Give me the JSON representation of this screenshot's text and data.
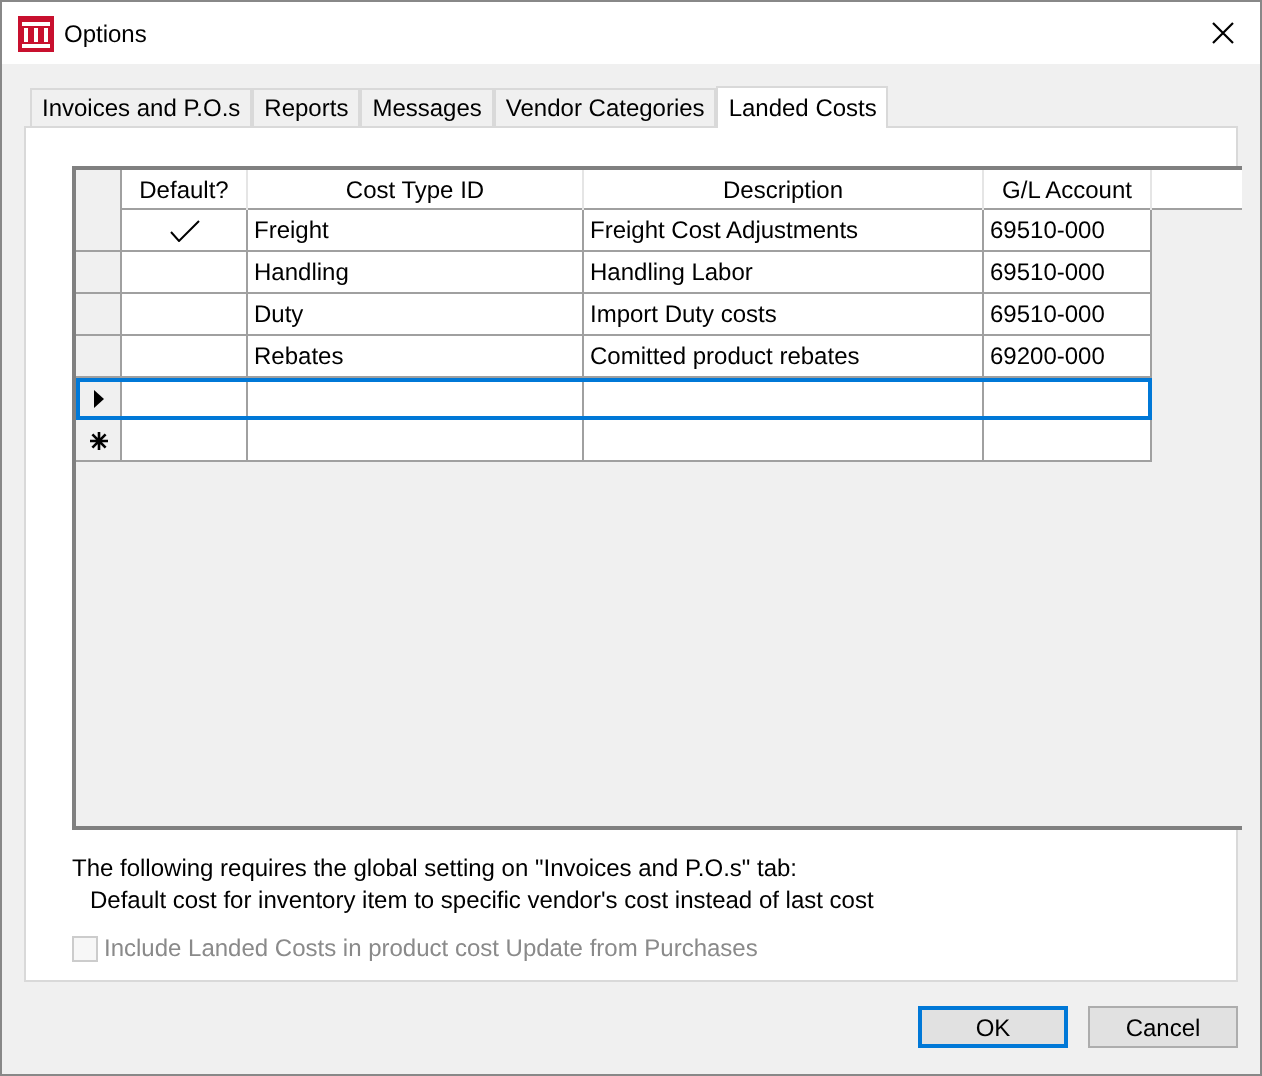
{
  "window": {
    "title": "Options"
  },
  "tabs": [
    {
      "label": "Invoices and P.O.s",
      "selected": false
    },
    {
      "label": "Reports",
      "selected": false
    },
    {
      "label": "Messages",
      "selected": false
    },
    {
      "label": "Vendor Categories",
      "selected": false
    },
    {
      "label": "Landed Costs",
      "selected": true
    }
  ],
  "table": {
    "columns": [
      "Default?",
      "Cost Type ID",
      "Description",
      "G/L Account"
    ],
    "rows": [
      {
        "kind": "data",
        "default": true,
        "cost_type_id": "Freight",
        "description": "Freight Cost Adjustments",
        "gl_account": "69510-000"
      },
      {
        "kind": "data",
        "default": false,
        "cost_type_id": "Handling",
        "description": "Handling Labor",
        "gl_account": "69510-000"
      },
      {
        "kind": "data",
        "default": false,
        "cost_type_id": "Duty",
        "description": "Import Duty costs",
        "gl_account": "69510-000"
      },
      {
        "kind": "data",
        "default": false,
        "cost_type_id": "Rebates",
        "description": "Comitted product rebates",
        "gl_account": "69200-000"
      },
      {
        "kind": "current"
      },
      {
        "kind": "new"
      }
    ]
  },
  "note": [
    "The following requires the global setting on \"Invoices and P.O.s\" tab:",
    "Default cost for inventory item to specific vendor's cost instead of last cost"
  ],
  "option": {
    "label": "Include Landed Costs in product cost Update from Purchases",
    "checked": false,
    "disabled": true
  },
  "buttons": [
    {
      "label": "OK",
      "default": true
    },
    {
      "label": "Cancel",
      "default": false
    }
  ]
}
